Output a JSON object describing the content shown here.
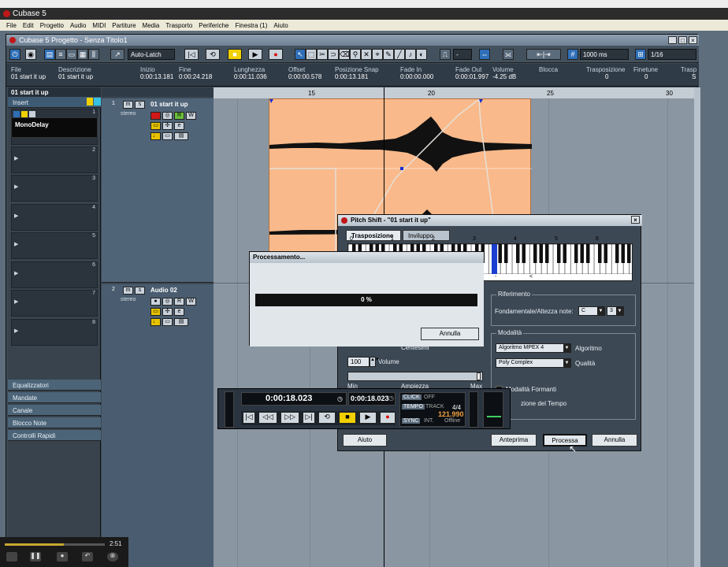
{
  "app": {
    "title": "Cubase 5"
  },
  "menu": [
    "File",
    "Edit",
    "Progetto",
    "Audio",
    "MIDI",
    "Partiture",
    "Media",
    "Trasporto",
    "Periferiche",
    "Finestra (1)",
    "Aiuto"
  ],
  "project": {
    "title": "Cubase 5 Progetto - Senza Titolo1"
  },
  "toolbar": {
    "automation_mode": "Auto-Latch",
    "snap_value": "1000 ms",
    "quantize": "1/16",
    "dash": "-"
  },
  "infoline": {
    "columns": [
      {
        "h": "File",
        "v": "01 start it up"
      },
      {
        "h": "Descrizione",
        "v": "01 start it up"
      },
      {
        "h": "Inizio",
        "v": "0:00:13.181"
      },
      {
        "h": "Fine",
        "v": "0:00:24.218"
      },
      {
        "h": "Lunghezza",
        "v": "0:00:11.036"
      },
      {
        "h": "Offset",
        "v": "0:00:00.578"
      },
      {
        "h": "Posizione Snap",
        "v": "0:00:13.181"
      },
      {
        "h": "Fade In",
        "v": "0:00:00.000"
      },
      {
        "h": "Fade Out",
        "v": "0:00:01.997"
      },
      {
        "h": "Volume",
        "v": "-4.25 dB"
      },
      {
        "h": "Blocca",
        "v": ""
      },
      {
        "h": "Trasposizione",
        "v": "0"
      },
      {
        "h": "Finetune",
        "v": "0"
      },
      {
        "h": "Trasp",
        "v": "S"
      }
    ]
  },
  "inspector": {
    "track_name": "01 start it up",
    "insert_label": "Insert",
    "plugin": "MonoDelay",
    "slots": [
      "1",
      "2",
      "3",
      "4",
      "5",
      "6",
      "7",
      "8"
    ],
    "sections": [
      "Equalizzatori",
      "Mandate",
      "Canale",
      "Blocco Note",
      "Controlli Rapidi"
    ]
  },
  "tracks": [
    {
      "num": "1",
      "name": "01 start it up",
      "sub": "stereo"
    },
    {
      "num": "2",
      "name": "Audio 02",
      "sub": "stereo"
    }
  ],
  "track_buttons": {
    "m": "m",
    "s": "s",
    "r": "R",
    "w": "W",
    "ri": "R",
    "wi": "W"
  },
  "ruler": [
    "15",
    "20",
    "25",
    "30"
  ],
  "pitch": {
    "title": "Pitch Shift - \"01 start it up\"",
    "tabs": [
      "Trasposizione",
      "Inviluppo"
    ],
    "octaves": [
      "0",
      "1",
      "2",
      "3",
      "4",
      "5",
      "6"
    ],
    "marker_minus": "-",
    "marker_lt": "<",
    "riferimento": {
      "title": "Riferimento",
      "label": "Fondamentale/Altezza note:",
      "note": "C",
      "octave": "3"
    },
    "modalita": {
      "title": "Modalità",
      "algorithm": "Algoritmo MPEX 4",
      "algorithm_label": "Algoritmo",
      "quality": "Poly Complex",
      "quality_label": "Qualità",
      "formanti": "Modalità Formanti",
      "tempo": "zione del Tempo"
    },
    "centesimi": "Centesimi",
    "volume_value": "100",
    "volume_label": "Volume",
    "ampiezza_min": "Min",
    "ampiezza": "Ampiezza",
    "ampiezza_max": "Max",
    "buttons": {
      "aiuto": "Aiuto",
      "anteprima": "Anteprima",
      "processa": "Processa",
      "annulla": "Annulla"
    }
  },
  "processing": {
    "title": "Processamento...",
    "progress": 0,
    "progress_label": "0 %",
    "cancel": "Annulla"
  },
  "transport": {
    "primary_time": "0:00:18.023",
    "secondary_time": "0:00:18.023",
    "click": "CLICK",
    "click_state": "OFF",
    "tempo": "TEMPO",
    "track": "TRACK",
    "signature": "4/4",
    "bpm": "121.990",
    "sync": "SYNC",
    "int": "INT.",
    "offline": "Offline"
  },
  "player": {
    "time": "2:51",
    "progress": 0.59
  },
  "colors": {
    "event": "#f9b98a",
    "accent": "#2e6fb8",
    "record": "#d01818"
  }
}
